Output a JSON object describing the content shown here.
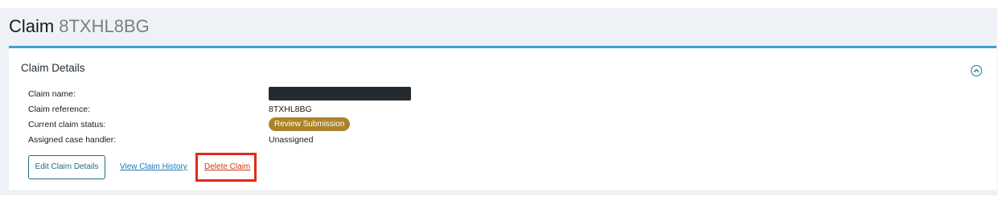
{
  "header": {
    "title": "Claim",
    "reference": "8TXHL8BG"
  },
  "panel": {
    "title": "Claim Details",
    "collapse_icon": "chevron-up-circle-icon",
    "rows": [
      {
        "label": "Claim name:",
        "value": ""
      },
      {
        "label": "Claim reference:",
        "value": "8TXHL8BG"
      },
      {
        "label": "Current claim status:",
        "value": "Review Submission"
      },
      {
        "label": "Assigned case handler:",
        "value": "Unassigned"
      }
    ]
  },
  "actions": {
    "edit_label": "Edit Claim Details",
    "history_label": "View Claim History",
    "delete_label": "Delete Claim"
  },
  "colors": {
    "accent": "#3ea1cf",
    "status_badge": "#ac8328",
    "highlight": "#e02b1a",
    "link": "#1a7ab6",
    "delete_link": "#cc3a10"
  }
}
